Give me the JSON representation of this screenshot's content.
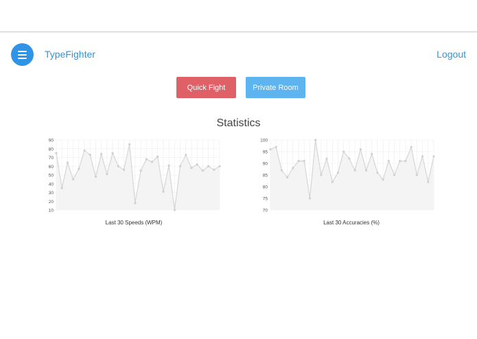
{
  "header": {
    "brand": "TypeFighter",
    "logout_label": "Logout",
    "menu_icon": "hamburger-icon"
  },
  "actions": {
    "quick_fight_label": "Quick Fight",
    "private_room_label": "Private Room"
  },
  "stats": {
    "title": "Statistics"
  },
  "colors": {
    "menu_button": "#2f93e6",
    "link": "#2b96e0",
    "quick_fight": "#e06068",
    "private_room": "#5db4ee",
    "line": "#d6d6d6",
    "fill": "#f4f4f4",
    "grid": "#ececec"
  },
  "chart_data": [
    {
      "type": "area",
      "title": "Last 30 Speeds (WPM)",
      "xlabel": "",
      "ylabel": "",
      "ylim": [
        10,
        90
      ],
      "yticks": [
        10,
        20,
        30,
        40,
        50,
        60,
        70,
        80,
        90
      ],
      "grid": true,
      "x": [
        1,
        2,
        3,
        4,
        5,
        6,
        7,
        8,
        9,
        10,
        11,
        12,
        13,
        14,
        15,
        16,
        17,
        18,
        19,
        20,
        21,
        22,
        23,
        24,
        25,
        26,
        27,
        28,
        29,
        30
      ],
      "values": [
        75,
        35,
        64,
        45,
        57,
        78,
        73,
        48,
        74,
        51,
        75,
        60,
        56,
        85,
        18,
        55,
        68,
        65,
        71,
        31,
        61,
        10,
        60,
        73,
        58,
        62,
        55,
        60,
        56,
        60
      ]
    },
    {
      "type": "area",
      "title": "Last 30 Accuracies (%)",
      "xlabel": "",
      "ylabel": "",
      "ylim": [
        70,
        100
      ],
      "yticks": [
        70,
        75,
        80,
        85,
        90,
        95,
        100
      ],
      "grid": true,
      "x": [
        1,
        2,
        3,
        4,
        5,
        6,
        7,
        8,
        9,
        10,
        11,
        12,
        13,
        14,
        15,
        16,
        17,
        18,
        19,
        20,
        21,
        22,
        23,
        24,
        25,
        26,
        27,
        28,
        29,
        30
      ],
      "values": [
        96,
        97,
        87,
        84,
        88,
        91,
        91,
        75,
        100,
        85,
        92,
        82,
        86,
        95,
        92,
        87,
        96,
        87,
        94,
        86,
        83,
        91,
        85,
        91,
        91,
        97,
        85,
        93,
        82,
        93
      ]
    }
  ]
}
